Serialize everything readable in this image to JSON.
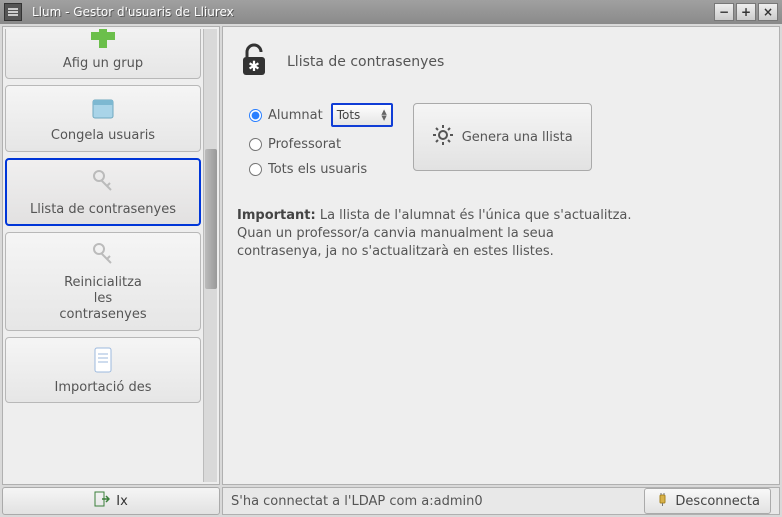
{
  "window": {
    "title": "Llum - Gestor d'usuaris de Lliurex",
    "minimize": "−",
    "maximize": "+",
    "close": "×"
  },
  "sidebar": {
    "items": [
      {
        "label": "Afig un grup",
        "icon": "plus-group-icon"
      },
      {
        "label": "Congela usuaris",
        "icon": "folder-freeze-icon"
      },
      {
        "label": "Llista de contrasenyes",
        "icon": "keys-icon",
        "active": true
      },
      {
        "label": "Reinicialitza\nles\ncontrasenyes",
        "icon": "keys-icon"
      },
      {
        "label": "Importació des",
        "icon": "document-icon"
      }
    ]
  },
  "exit_label": "Ix",
  "panel": {
    "title": "Llista de contrasenyes",
    "radios": {
      "alumnat": "Alumnat",
      "professorat": "Professorat",
      "tots": "Tots els usuaris"
    },
    "filter_value": "Tots",
    "generate_label": "Genera una llista",
    "info_label": "Important:",
    "info_text": "La llista de l'alumnat és l'única que s'actualitza.\nQuan un professor/a canvia manualment la seua\ncontrasenya, ja no s'actualitzarà en estes llistes."
  },
  "status": {
    "text": "S'ha connectat a l'LDAP com a:admin0",
    "disconnect": "Desconnecta"
  }
}
